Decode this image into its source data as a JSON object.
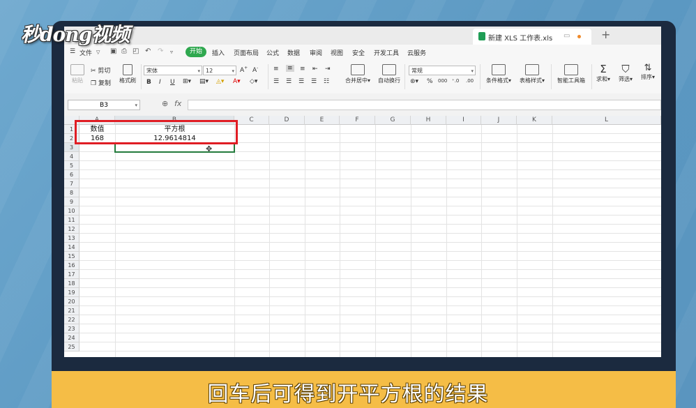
{
  "watermark": "秒dong视频",
  "subtitle": "回车后可得到开平方根的结果",
  "window": {
    "file_tab": "新建 XLS 工作表.xls",
    "new_tab": "+"
  },
  "menu": {
    "file": "文件",
    "start": "开始",
    "items": [
      "插入",
      "页面布局",
      "公式",
      "数据",
      "审阅",
      "视图",
      "安全",
      "开发工具",
      "云服务"
    ]
  },
  "ribbon": {
    "paste": "粘贴",
    "cut": "剪切",
    "copy": "复制",
    "format_painter": "格式刷",
    "font_name": "宋体",
    "font_size": "12",
    "merge_center": "合并居中",
    "wrap": "自动换行",
    "number_format": "常规",
    "cond_format": "条件格式",
    "table_style": "表格样式",
    "smart_toolbox": "智能工具箱",
    "sum": "求和",
    "filter": "筛选",
    "sort": "排序"
  },
  "formula_bar": {
    "name_box": "B3",
    "fx": "fx"
  },
  "sheet": {
    "columns": [
      "A",
      "B",
      "C",
      "D",
      "E",
      "F",
      "G",
      "H",
      "I",
      "J",
      "K",
      "L"
    ],
    "rows": [
      "1",
      "2",
      "3",
      "4",
      "5",
      "6",
      "7",
      "8",
      "9",
      "10",
      "11",
      "12",
      "13",
      "14",
      "15",
      "16",
      "17",
      "18",
      "19",
      "20",
      "21",
      "22",
      "23",
      "24",
      "25"
    ],
    "cells": {
      "A1": "数值",
      "B1": "平方根",
      "A2": "168",
      "B2": "12.9614814"
    },
    "accent_colors": {
      "selection": "#237b3c",
      "highlight": "#e01d24",
      "start_tab": "#2fa84f"
    }
  }
}
